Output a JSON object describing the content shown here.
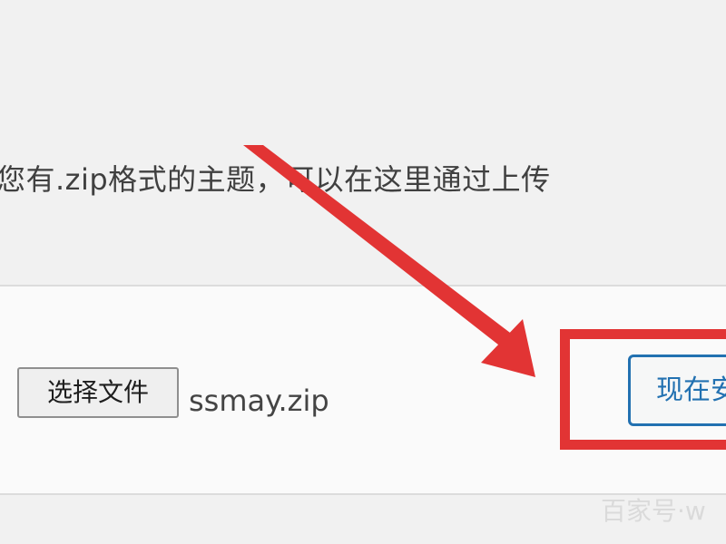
{
  "intro": {
    "text": "您有.zip格式的主题，可以在这里通过上传"
  },
  "upload": {
    "choose_file_label": "选择文件",
    "file_name": "ssmay.zip",
    "install_label": "现在安"
  },
  "annotation": {
    "highlight_color": "#e23434"
  },
  "watermark": {
    "text": "百家号·w"
  }
}
